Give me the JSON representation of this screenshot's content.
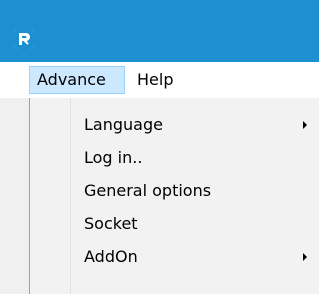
{
  "window": {
    "app_icon": "app-logo-icon"
  },
  "menubar": {
    "items": [
      {
        "label": "Advance",
        "active": true
      },
      {
        "label": "Help",
        "active": false
      }
    ]
  },
  "dropdown": {
    "items": [
      {
        "label": "Language",
        "has_submenu": true
      },
      {
        "label": "Log in..",
        "has_submenu": false
      },
      {
        "label": "General options",
        "has_submenu": false
      },
      {
        "label": "Socket",
        "has_submenu": false
      },
      {
        "label": "AddOn",
        "has_submenu": true
      }
    ]
  },
  "colors": {
    "titlebar": "#1e8fd0",
    "menu_highlight": "#cce8ff",
    "menu_highlight_border": "#99d1ff",
    "dropdown_bg": "#f2f2f2"
  }
}
